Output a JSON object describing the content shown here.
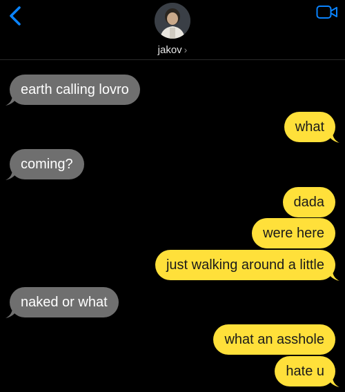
{
  "header": {
    "contact_name": "jakov",
    "chevron": "›",
    "icons": {
      "back": "chevron-left-icon",
      "video": "video-camera-icon"
    },
    "accent_color": "#0a84ff"
  },
  "colors": {
    "incoming_bubble": "#6f6f6f",
    "outgoing_bubble": "#ffe03a",
    "background": "#000000"
  },
  "messages": [
    {
      "sender": "jakov",
      "direction": "incoming",
      "text": "earth calling lovro"
    },
    {
      "sender": "me",
      "direction": "outgoing",
      "text": "what"
    },
    {
      "sender": "jakov",
      "direction": "incoming",
      "text": "coming?"
    },
    {
      "sender": "me",
      "direction": "outgoing",
      "text": "dada"
    },
    {
      "sender": "me",
      "direction": "outgoing",
      "text": "were here"
    },
    {
      "sender": "me",
      "direction": "outgoing",
      "text": "just walking around a little"
    },
    {
      "sender": "jakov",
      "direction": "incoming",
      "text": "naked or what"
    },
    {
      "sender": "me",
      "direction": "outgoing",
      "text": "what an asshole"
    },
    {
      "sender": "me",
      "direction": "outgoing",
      "text": "hate u"
    }
  ]
}
